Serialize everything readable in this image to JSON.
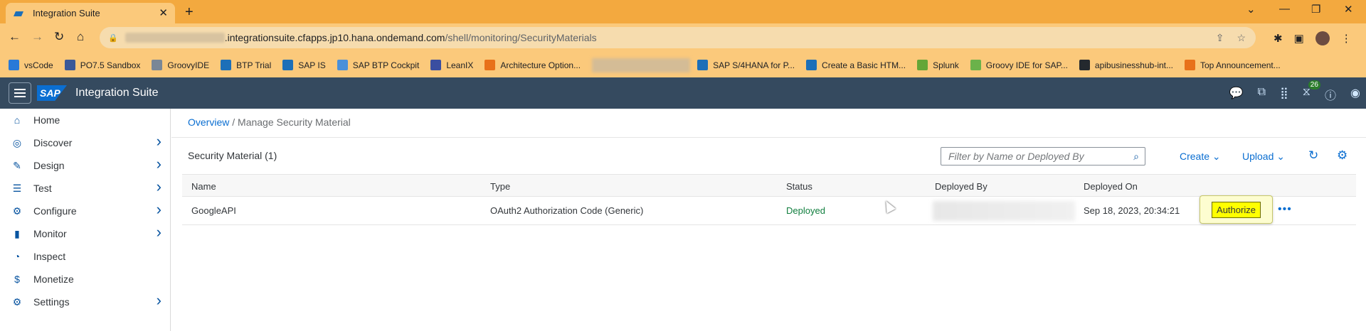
{
  "browser": {
    "tab_title": "Integration Suite",
    "url_host": ".integrationsuite.cfapps.jp10.hana.ondemand.com",
    "url_path": "/shell/monitoring/SecurityMaterials",
    "bookmarks": [
      {
        "label": "vsCode",
        "color": "#2979d8"
      },
      {
        "label": "PO7.5 Sandbox",
        "color": "#3b5998"
      },
      {
        "label": "GroovyIDE",
        "color": "#7a8796"
      },
      {
        "label": "BTP Trial",
        "color": "#1d6fb8"
      },
      {
        "label": "SAP IS",
        "color": "#1d6fb8"
      },
      {
        "label": "SAP BTP Cockpit",
        "color": "#4a90d9"
      },
      {
        "label": "LeanIX",
        "color": "#3a4ea0"
      },
      {
        "label": "Architecture Option...",
        "color": "#e8711a"
      },
      {
        "label": "SAP S/4HANA for P...",
        "color": "#1d6fb8"
      },
      {
        "label": "Create a Basic HTM...",
        "color": "#1d6fb8"
      },
      {
        "label": "Splunk",
        "color": "#65a637"
      },
      {
        "label": "Groovy IDE for SAP...",
        "color": "#6bb24a"
      },
      {
        "label": "apibusinesshub-int...",
        "color": "#24292e"
      },
      {
        "label": "Top Announcement...",
        "color": "#e8711a"
      }
    ]
  },
  "shell": {
    "logo": "SAP",
    "title": "Integration Suite",
    "notification_count": "26"
  },
  "sidenav": {
    "items": [
      {
        "label": "Home",
        "icon": "home-icon",
        "glyph": "⌂",
        "has_chevron": false
      },
      {
        "label": "Discover",
        "icon": "compass-icon",
        "glyph": "◎",
        "has_chevron": true
      },
      {
        "label": "Design",
        "icon": "pencil-icon",
        "glyph": "✎",
        "has_chevron": true
      },
      {
        "label": "Test",
        "icon": "checklist-icon",
        "glyph": "☰",
        "has_chevron": true
      },
      {
        "label": "Configure",
        "icon": "configure-icon",
        "glyph": "⚙",
        "has_chevron": true
      },
      {
        "label": "Monitor",
        "icon": "bar-chart-icon",
        "glyph": "▮",
        "has_chevron": true
      },
      {
        "label": "Inspect",
        "icon": "gauge-icon",
        "glyph": "◔",
        "has_chevron": false
      },
      {
        "label": "Monetize",
        "icon": "dollar-icon",
        "glyph": "$",
        "has_chevron": false
      },
      {
        "label": "Settings",
        "icon": "gear-icon",
        "glyph": "⚙",
        "has_chevron": true
      }
    ]
  },
  "breadcrumb": {
    "link": "Overview",
    "separator": " / ",
    "current": "Manage Security Material"
  },
  "toolbar": {
    "title": "Security Material (1)",
    "filter_placeholder": "Filter by Name or Deployed By",
    "create_label": "Create",
    "upload_label": "Upload"
  },
  "table": {
    "columns": [
      "Name",
      "Type",
      "Status",
      "Deployed By",
      "Deployed On"
    ],
    "rows": [
      {
        "name": "GoogleAPI",
        "type": "OAuth2 Authorization Code (Generic)",
        "status": "Deployed",
        "deployed_on": "Sep 18, 2023, 20:34:21",
        "action": "Authorize"
      }
    ]
  }
}
